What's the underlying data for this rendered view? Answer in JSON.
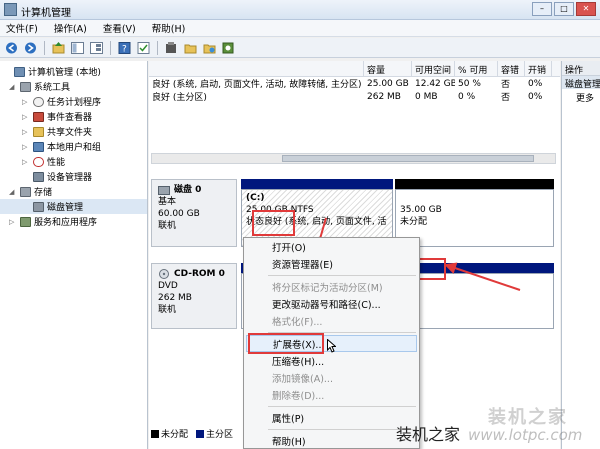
{
  "window": {
    "title": "计算机管理"
  },
  "menu": [
    "文件(F)",
    "操作(A)",
    "查看(V)",
    "帮助(H)"
  ],
  "toolbar": [
    "back-icon",
    "forward-icon",
    "up-icon",
    "show-tree-icon",
    "help-icon",
    "console-icon",
    "properties-icon",
    "open-icon",
    "save-icon",
    "settings-icon"
  ],
  "tree": [
    {
      "label": "计算机管理 (本地)",
      "icon": "computer-icon",
      "indent": 0
    },
    {
      "label": "系统工具",
      "icon": "tools-icon",
      "indent": 1
    },
    {
      "label": "任务计划程序",
      "icon": "clock-icon",
      "indent": 2
    },
    {
      "label": "事件查看器",
      "icon": "event-icon",
      "indent": 2
    },
    {
      "label": "共享文件夹",
      "icon": "share-icon",
      "indent": 2
    },
    {
      "label": "本地用户和组",
      "icon": "users-icon",
      "indent": 2
    },
    {
      "label": "性能",
      "icon": "perf-icon",
      "indent": 2
    },
    {
      "label": "设备管理器",
      "icon": "device-icon",
      "indent": 2
    },
    {
      "label": "存储",
      "icon": "storage-icon",
      "indent": 1
    },
    {
      "label": "磁盘管理",
      "icon": "disk-icon",
      "indent": 2
    },
    {
      "label": "服务和应用程序",
      "icon": "services-icon",
      "indent": 1
    }
  ],
  "volume_table": {
    "headers": [
      "",
      "容量",
      "可用空间",
      "% 可用",
      "容错",
      "开销"
    ],
    "rows": [
      [
        "良好 (系统, 启动, 页面文件, 活动, 故障转储, 主分区)",
        "25.00 GB",
        "12.42 GB",
        "50 %",
        "否",
        "0%"
      ],
      [
        "良好 (主分区)",
        "262 MB",
        "0 MB",
        "0 %",
        "否",
        "0%"
      ]
    ]
  },
  "disks": {
    "disk0": {
      "name": "磁盘 0",
      "type": "基本",
      "size": "60.00 GB",
      "status": "联机"
    },
    "cdrom": {
      "name": "CD-ROM 0",
      "type": "DVD",
      "size": "262 MB",
      "status": "联机"
    },
    "partition_c": {
      "letter": "(C:)",
      "size": "25.00 GB NTFS",
      "status": "状态良好 (系统, 启动, 页面文件, 活"
    },
    "unallocated": {
      "size": "35.00 GB",
      "label": "未分配"
    }
  },
  "legend": {
    "unallocated": "未分配",
    "primary": "主分区",
    "unallocated_color": "#000000",
    "primary_color": "#00177d"
  },
  "context_menu": {
    "items": [
      {
        "label": "打开(O)",
        "disabled": false
      },
      {
        "label": "资源管理器(E)",
        "disabled": false
      },
      {
        "sep": true
      },
      {
        "label": "将分区标记为活动分区(M)",
        "disabled": true
      },
      {
        "label": "更改驱动器号和路径(C)...",
        "disabled": false
      },
      {
        "label": "格式化(F)...",
        "disabled": true
      },
      {
        "sep": true
      },
      {
        "label": "扩展卷(X)...",
        "disabled": false,
        "highlight": true
      },
      {
        "label": "压缩卷(H)...",
        "disabled": false
      },
      {
        "label": "添加镜像(A)...",
        "disabled": true
      },
      {
        "label": "删除卷(D)...",
        "disabled": true
      },
      {
        "sep": true
      },
      {
        "label": "属性(P)",
        "disabled": false
      },
      {
        "sep": true
      },
      {
        "label": "帮助(H)",
        "disabled": false
      }
    ]
  },
  "actions": {
    "header": "操作",
    "sub": "磁盘管理",
    "more": "更多"
  },
  "watermark": {
    "line1": "装机之家",
    "line2": "装机之家",
    "url": "www.lotpc.com"
  }
}
